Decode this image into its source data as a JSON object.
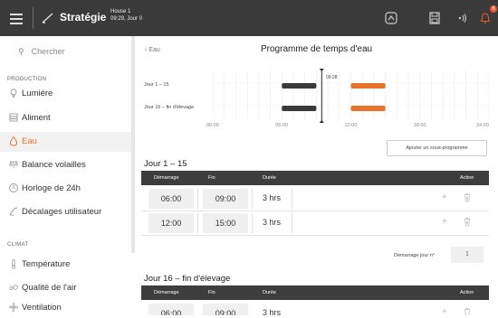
{
  "topbar": {
    "title": "Stratégie",
    "house_name": "House 1",
    "house_time": "09:29, Jour 0",
    "notification_count": "6"
  },
  "search": {
    "placeholder": "Chercher"
  },
  "sidebar": {
    "production_label": "PRODUCTION",
    "production_items": [
      {
        "label": "Lumière",
        "icon": "lightbulb-icon"
      },
      {
        "label": "Aliment",
        "icon": "feed-icon"
      },
      {
        "label": "Eau",
        "icon": "water-drop-icon",
        "active": true
      },
      {
        "label": "Balance volailles",
        "icon": "scale-icon"
      },
      {
        "label": "Horloge de 24h",
        "icon": "clock-icon"
      },
      {
        "label": "Décalages utilisateur",
        "icon": "offset-icon"
      }
    ],
    "climat_label": "CLIMAT",
    "climat_items": [
      {
        "label": "Température",
        "icon": "thermometer-icon"
      },
      {
        "label": "Qualité de l'air",
        "icon": "air-quality-icon"
      },
      {
        "label": "Ventilation",
        "icon": "fan-icon"
      }
    ]
  },
  "main": {
    "back_label": "Eau",
    "title": "Programme de temps d'eau",
    "add_subprogram": "Ajouter un sous-programme",
    "demarrage_label": "Démarrage jour n°",
    "demarrage_value": "1"
  },
  "chart_data": {
    "type": "gantt",
    "current_time": "09:28",
    "x_ticks": [
      "00:00",
      "06:00",
      "12:00",
      "18:00",
      "24:00"
    ],
    "rows": [
      {
        "label": "Jour 1 – 15",
        "segments": [
          {
            "start": "06:00",
            "end": "09:00",
            "status": "past"
          },
          {
            "start": "12:00",
            "end": "15:00",
            "status": "future"
          }
        ]
      },
      {
        "label": "Jour 16 – fin d'élevage",
        "segments": [
          {
            "start": "06:00",
            "end": "09:00",
            "status": "past"
          },
          {
            "start": "12:00",
            "end": "15:00",
            "status": "future"
          }
        ]
      }
    ],
    "colors": {
      "past": "#3a3a3a",
      "future": "#e8712c"
    }
  },
  "table_headers": [
    "Démarrage",
    "Fin",
    "Durée",
    "Action"
  ],
  "groups": [
    {
      "title": "Jour 1 – 15",
      "rows": [
        {
          "start": "06:00",
          "end": "09:00",
          "duration": "3 hrs"
        },
        {
          "start": "12:00",
          "end": "15:00",
          "duration": "3 hrs"
        }
      ]
    },
    {
      "title": "Jour 16 – fin d'élevage",
      "rows": [
        {
          "start": "06:00",
          "end": "09:00",
          "duration": "3 hrs"
        }
      ]
    }
  ],
  "colors": {
    "accent": "#e8712c",
    "dark": "#3a3a3a"
  }
}
